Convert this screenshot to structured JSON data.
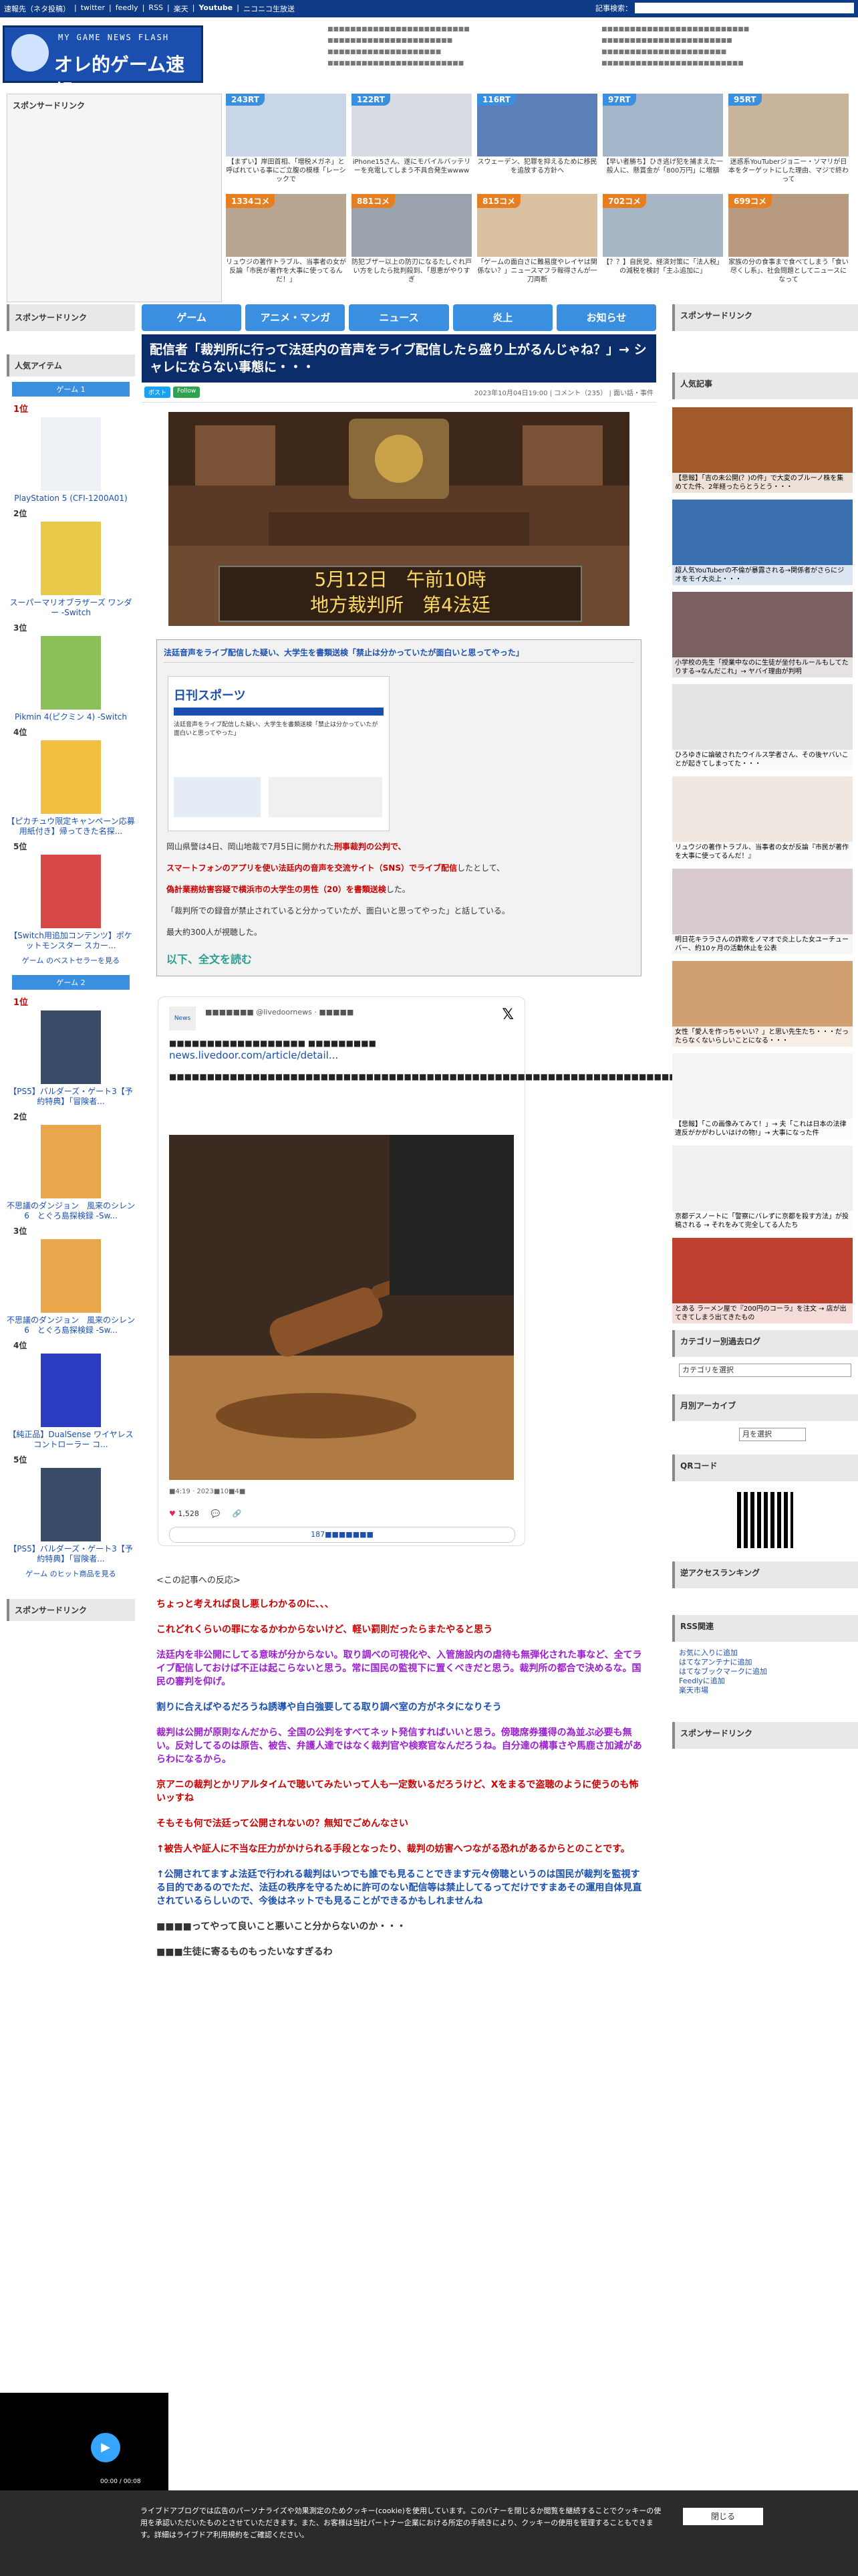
{
  "topbar": {
    "links": [
      "速報先（ネタ投稿）",
      "twitter",
      "feedly",
      "RSS",
      "楽天",
      "Youtube",
      "ニコニコ生放送"
    ],
    "search_label": "記事検索：",
    "search_placeholder": ""
  },
  "logo": {
    "small": "MY GAME NEWS FLASH",
    "big": "オレ的ゲーム速報@JIN"
  },
  "sidebar": {
    "sponsor": "スポンサードリンク",
    "popular_items": "人気アイテム",
    "game1_tab": "ゲーム 1",
    "game2_tab": "ゲーム 2",
    "game1": [
      {
        "rank": "1位",
        "name": "PlayStation 5 (CFI-1200A01)"
      },
      {
        "rank": "2位",
        "name": "スーパーマリオブラザーズ ワンダー -Switch"
      },
      {
        "rank": "3位",
        "name": "Pikmin 4(ピクミン 4) -Switch"
      },
      {
        "rank": "4位",
        "name": "【ピカチュウ限定キャンペーン応募用紙付き】帰ってきた名探..."
      },
      {
        "rank": "5位",
        "name": "【Switch用追加コンテンツ】ポケットモンスター スカー..."
      }
    ],
    "game1_more": "ゲーム のベストセラーを見る",
    "game2": [
      {
        "rank": "1位",
        "name": "【PS5】バルダーズ・ゲート3【予約特典】「冒険者..."
      },
      {
        "rank": "2位",
        "name": "不思議のダンジョン　風来のシレン6　とぐろ島探検録 -Sw..."
      },
      {
        "rank": "3位",
        "name": "不思議のダンジョン　風来のシレン6　とぐろ島探検録 -Sw..."
      },
      {
        "rank": "4位",
        "name": "【純正品】DualSense ワイヤレスコントローラー コ..."
      },
      {
        "rank": "5位",
        "name": "【PS5】バルダーズ・ゲート3【予約特典】「冒険者..."
      }
    ],
    "game2_more": "ゲーム のヒット商品を見る",
    "sponsor_bottom": "スポンサードリンク"
  },
  "nav": [
    "ゲーム",
    "アニメ・マンガ",
    "ニュース",
    "炎上",
    "お知らせ"
  ],
  "right": {
    "sponsor": "スポンサードリンク",
    "popular": "人気記事",
    "articles": [
      "【悲報】「吉の未公開(？)の件」で大変のブルーノ株を集めてた件、2年経ったらとうとう・・・",
      "超人気YouTuberの不倫が暴露される→関係者がさらにジオをモイ大炎上・・・",
      "小学校の先生「授業中なのに生徒が坐付もルールもしてたりする→なんだこれ」→ ヤバイ理由が判明",
      "ひろゆきに論破されたウイルス学者さん、その後ヤバいことが起きてしまってた・・・",
      "リュウジの著作トラブル、当事者の女が反論『市民が著作を大事に使ってるんだ！』",
      "明日花キララさんの詐欺をノマオで炎上した女ユーチューバー、約10ヶ月の活動休止を公表",
      "女性「愛人を作っちゃいい？」と思い先生たち・・・だったらなくないらしいことになる・・・",
      "【悲報】「この画像みてみて！」→ 夫「これは日本の法律違反がかがわしいはけの物!」→ 大事になった件",
      "京都デスノートに「警察にバレずに京都を殺す方法」が投稿される → それをみて完全してる人たち",
      "とある ラーメン屋で『200円のコーラ』を注文 → 店が出てきてしまう出てきたもの"
    ],
    "category_log": "カテゴリー別過去ログ",
    "category_select": "カテゴリを選択",
    "monthly": "月別アーカイブ",
    "monthly_select": "月を選択",
    "qr": "QRコード",
    "reverse": "逆アクセスランキング",
    "rss": "RSS関連",
    "rss_links": [
      "お気に入りに追加",
      "はてなアンテナに追加",
      "はてなブックマークに追加",
      "Feedlyに追加",
      "楽天市場"
    ],
    "sponsor_bottom": "スポンサードリンク"
  },
  "rt": [
    {
      "badge": "243RT",
      "color": "#3b8fe0",
      "cap": "【まずい】岸田首相、「増税メガネ」と呼ばれている事にご立腹の模様「レーシックで"
    },
    {
      "badge": "122RT",
      "color": "#3b8fe0",
      "cap": "iPhone15さん、遂にモバイルバッテリーを充電してしまう不具合発生wwww"
    },
    {
      "badge": "116RT",
      "color": "#3b8fe0",
      "cap": "スウェーデン、犯罪を抑えるために移民を追放する方針へ"
    },
    {
      "badge": "97RT",
      "color": "#3b8fe0",
      "cap": "【早い者勝ち】ひき逃げ犯を捕まえた一般人に、懸賞金が「800万円」に増額"
    },
    {
      "badge": "95RT",
      "color": "#3b8fe0",
      "cap": "迷惑系YouTuberジョニー・ソマリが日本をターゲットにした理由、マジで終わって"
    },
    {
      "badge": "1334コメ",
      "color": "#e67e22",
      "cap": "リュウジの著作トラブル、当事者の女が反論「市民が著作を大事に使ってるんだ！」"
    },
    {
      "badge": "881コメ",
      "color": "#e67e22",
      "cap": "防犯ブザー以上の防刃になるたしぐれ戸い方をしたら批判殺到、「恩恵がやりすぎ"
    },
    {
      "badge": "815コメ",
      "color": "#e67e22",
      "cap": "「ゲームの面白さに難易度やレイヤは関係ない？」ニュースマフラ報得さんが一刀両断"
    },
    {
      "badge": "702コメ",
      "color": "#e67e22",
      "cap": "【？？】自民党、経済対策に「法人税」の減税を検討「主ふ追加に」"
    },
    {
      "badge": "699コメ",
      "color": "#e67e22",
      "cap": "家族の分の食事まで食べてしまう「食い尽くし系」、社会問題としてニュースになって"
    }
  ],
  "header_news_col1": [
    "■■■■■■■■■■■■■■■■■■■■■■■■■",
    "■■■■■■■■■■■■■■■■■■■■■■",
    "■■■■■■■■■■■■■■■■■■■■",
    "■■■■■■■■■■■■■■■■■■■■■■■■"
  ],
  "header_news_col2": [
    "■■■■■■■■■■■■■■■■■■■■■■■■■■",
    "■■■■■■■■■■■■■■■■■■■■■■■",
    "■■■■■■■■■■■■■■■■■■■■■■",
    "■■■■■■■■■■■■■■■■■■■■■■■■■"
  ],
  "article": {
    "title": "配信者「裁判所に行って法廷内の音声をライブ配信したら盛り上がるんじゃね？」→ シャレにならない事態に・・・",
    "date": "2023年10月04日19:00",
    "comments": "コメント（235）",
    "category": "面い話・事件",
    "hero_line1": "5月12日　午前10時",
    "hero_line2": "地方裁判所　第4法廷",
    "source_head": "法廷音声をライブ配信した疑い、大学生を書類送検「禁止は分かっていたが面白いと思ってやった」",
    "paper_brand": "日刊スポーツ",
    "p1_a": "岡山県警は4日、岡山地裁で7月5日に開かれた",
    "p1_b": "刑事裁判の公判で、",
    "p2_a": "スマートフォンのアプリを使い法廷内の音声を交流サイト（SNS）でライブ配信",
    "p2_b": "したとして、",
    "p3_a": "偽計業務妨害容疑で横浜市の大学生の男性（20）を書類送検",
    "p3_b": "した。",
    "p4": "「裁判所での録音が禁止されていると分かっていたが、面白いと思ってやった」と話している。",
    "p5": "最大約300人が視聴した。",
    "read_more": "以下、全文を読む"
  },
  "tweet": {
    "user": "■■■■■■■ @livedoornews · ■■■■■",
    "avatar": "News",
    "line1": "■■■■■■■■■■■■■■■■■■ ■■■■■■■■■",
    "link": "news.livedoor.com/article/detail...",
    "body": "■■■■■■■■■■■■■■■■■■■■■■■■■■■■■■■■■■■■■■■■■■■■■■■■■■■■■■■■■■■■■■■■■■■■■■■■■■■■■■",
    "time": "■4:19 · 2023■10■4■",
    "likes": "1,528",
    "replies": "187■■■■■■■"
  },
  "reactions": {
    "header": "<この記事への反応>",
    "items": [
      {
        "text": "ちょっと考えれば良し悪しわかるのに、、、",
        "color": "#c00"
      },
      {
        "text": "これどれくらいの罪になるかわからないけど、軽い罰則だったらまたやると思う",
        "color": "#c00"
      },
      {
        "text": "法廷内を非公開にしてる意味が分からない。取り調べの可視化や、入管施設内の虐待も無弾化された事など、全てライブ配信しておけば不正は起こらないと思う。常に国民の監視下に置くべきだと思う。裁判所の都合で決めるな。国民の審判を仰げ。",
        "color": "#9b1fd0"
      },
      {
        "text": "割りに合えばやるだろうね誘導や自白強要してる取り調べ室の方がネタになりそう",
        "color": "#1a4fb0"
      },
      {
        "text": "裁判は公開が原則なんだから、全国の公判をすべてネット発信すればいいと思う。傍聴席券獲得の為並ぶ必要も無い。反対してるのは原告、被告、弁護人達ではなく裁判官や検察官なんだろうね。自分達の構事さや馬鹿さ加減があらわになるから。",
        "color": "#9b1fd0"
      },
      {
        "text": "京アニの裁判とかリアルタイムで聴いてみたいって人も一定数いるだろうけど、Xをまるで盗聴のように使うのも怖いッすね",
        "color": "#c00"
      },
      {
        "text": "そもそも何で法廷って公開されないの？無知でごめんなさい",
        "color": "#c00"
      },
      {
        "text": "↑被告人や証人に不当な圧力がかけられる手段となったり、裁判の妨害へつながる恐れがあるからとのことです。",
        "color": "#c00"
      },
      {
        "text": "↑公開されてますよ法廷で行われる裁判はいつでも誰でも見ることできます元々傍聴というのは国民が裁判を監視する目的であるのでただ、法廷の秩序を守るために許可のない配信等は禁止してるってだけですまあその運用自体見直されているらしいので、今後はネットでも見ることができるかもしれませんね",
        "color": "#1a4fb0"
      },
      {
        "text": "■■■■ってやって良いこと悪いこと分からないのか・・・",
        "color": "#333"
      },
      {
        "text": "■■■生徒に寄るものもったいなすぎるわ",
        "color": "#333"
      }
    ]
  },
  "cookie": {
    "text": "ライブドアブログでは広告のパーソナライズや効果測定のためクッキー(cookie)を使用しています。このバナーを閉じるか閲覧を継続することでクッキーの使用を承認いただいたものとさせていただきます。また、お客様は当社パートナー企業における所定の手続きにより、クッキーの使用を管理することもできます。詳細はライブドア利用規約をご確認ください。",
    "close": "閉じる"
  },
  "player": {
    "time": "00:00 / 00:08"
  }
}
